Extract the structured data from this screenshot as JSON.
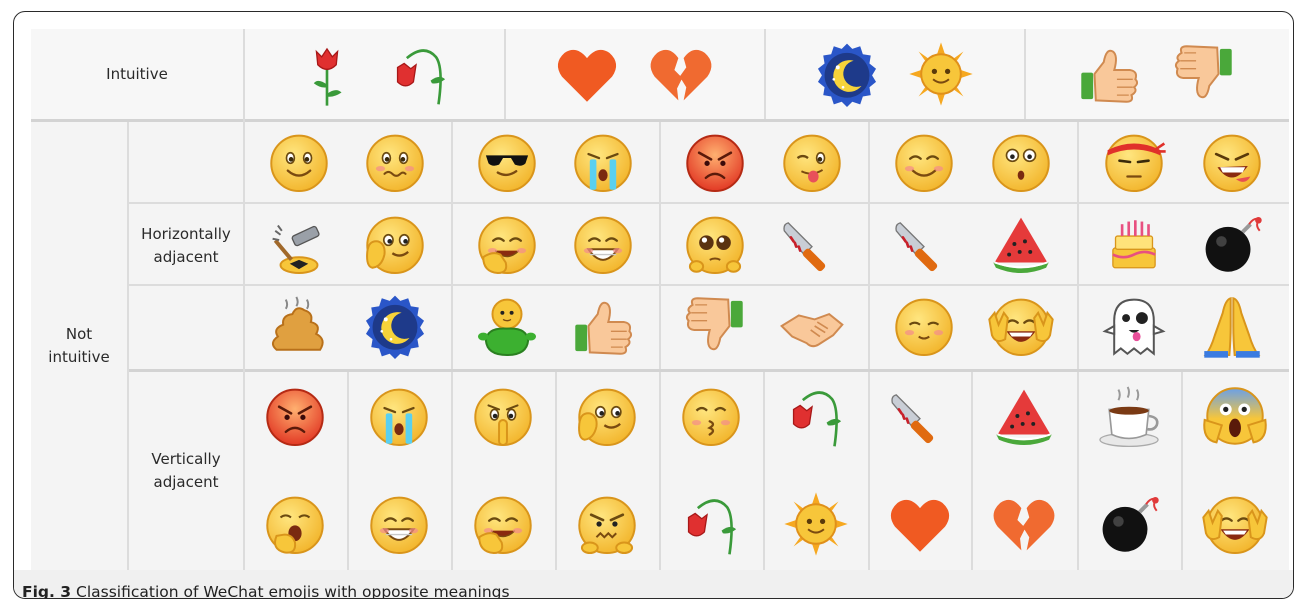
{
  "figure": {
    "caption_label": "Fig. 3",
    "caption_text": "Classification of WeChat emojis with opposite meanings"
  },
  "rows": {
    "intuitive_label": "Intuitive",
    "not_intuitive_label": "Not\nintuitive",
    "horizontal_label": "Horizontally\nadjacent",
    "vertical_label": "Vertically\nadjacent"
  },
  "intuitive_pairs": [
    [
      "rose-icon",
      "wilted-rose-icon"
    ],
    [
      "heart-icon",
      "broken-heart-icon"
    ],
    [
      "moon-icon",
      "sun-icon"
    ],
    [
      "thumbs-up-icon",
      "thumbs-down-icon"
    ]
  ],
  "horizontal_rows": [
    [
      [
        "smile-icon",
        "awkward-icon"
      ],
      [
        "cool-icon",
        "crying-icon"
      ],
      [
        "angry-icon",
        "wink-tongue-icon"
      ],
      [
        "blush-icon",
        "surprised-icon"
      ],
      [
        "ninja-icon",
        "evil-grin-icon"
      ]
    ],
    [
      [
        "hammer-icon",
        "facepalm-icon"
      ],
      [
        "chuckle-icon",
        "grin-icon"
      ],
      [
        "puppy-eyes-icon",
        "knife-icon"
      ],
      [
        "knife-icon",
        "watermelon-icon"
      ],
      [
        "cake-icon",
        "bomb-icon"
      ]
    ],
    [
      [
        "poop-icon",
        "moon-icon"
      ],
      [
        "green-toy-icon",
        "thumbs-up-icon"
      ],
      [
        "thumbs-down-icon",
        "handshake-icon"
      ],
      [
        "shy-smile-icon",
        "peace-smile-icon"
      ],
      [
        "ghost-icon",
        "pray-icon"
      ]
    ]
  ],
  "vertical_columns": [
    [
      "angry-icon",
      "yawn-icon"
    ],
    [
      "crying-icon",
      "grin-icon"
    ],
    [
      "shush-icon",
      "chuckle-icon"
    ],
    [
      "facepalm-icon",
      "frown-icon"
    ],
    [
      "kiss-icon",
      "wilted-rose-icon"
    ],
    [
      "wilted-rose-icon",
      "sun-icon"
    ],
    [
      "knife-icon",
      "heart-icon"
    ],
    [
      "watermelon-icon",
      "broken-heart-icon"
    ],
    [
      "coffee-icon",
      "bomb-icon"
    ],
    [
      "scream-icon",
      "peace-smile-icon"
    ]
  ],
  "colors": {
    "face": "#f7c63a",
    "face_edge": "#d9951b",
    "heart": "#f05a22",
    "rose": "#d92f2f",
    "grid_line": "#dcdcdc",
    "caption_bg": "#f0f0f0"
  }
}
